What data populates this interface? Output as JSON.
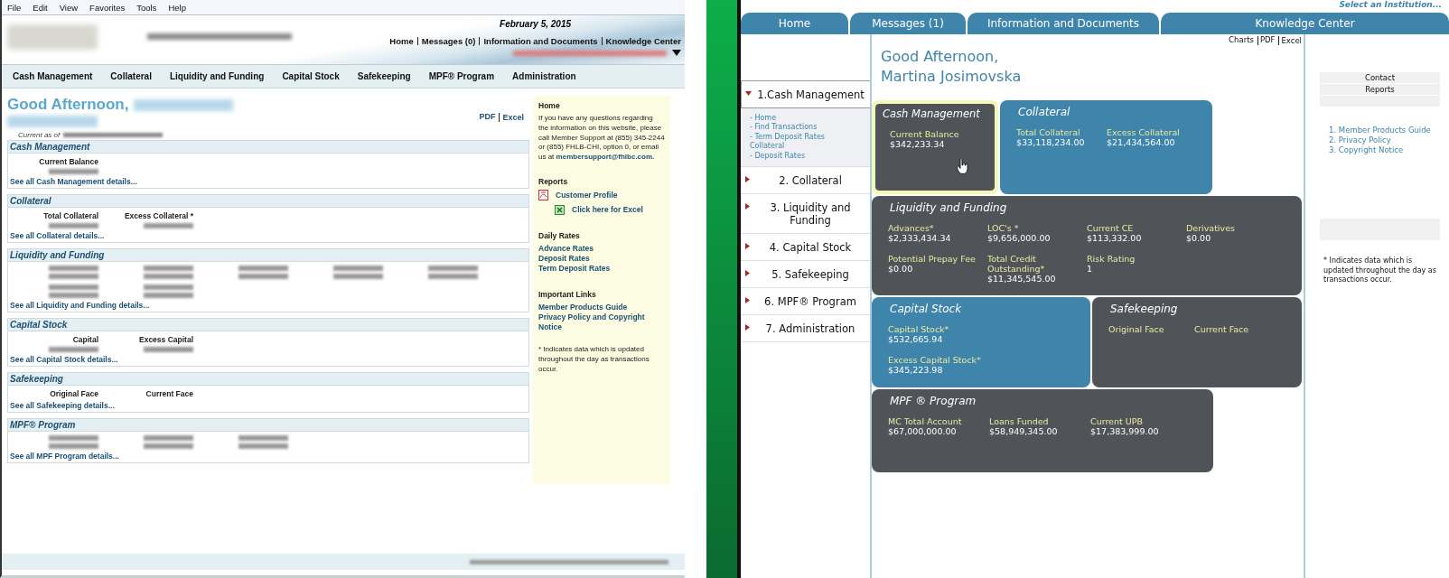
{
  "left_screen": {
    "menu_bar": [
      "File",
      "Edit",
      "View",
      "Favorites",
      "Tools",
      "Help"
    ],
    "date": "February 5, 2015",
    "top_links": [
      "Home",
      "Messages (0)",
      "Information and Documents",
      "Knowledge Center"
    ],
    "nav": [
      "Cash Management",
      "Collateral",
      "Liquidity and Funding",
      "Capital Stock",
      "Safekeeping",
      "MPF® Program",
      "Administration"
    ],
    "greeting": "Good Afternoon,",
    "current_as_of": "Current as of",
    "export_links": [
      "PDF",
      "Excel"
    ],
    "sections": [
      {
        "title": "Cash Management",
        "fields": [
          {
            "label": "Current Balance",
            "kind": "blurred_value"
          }
        ],
        "link": "See all Cash Management details..."
      },
      {
        "title": "Collateral",
        "fields": [
          {
            "label": "Total Collateral",
            "kind": "blurred_value"
          },
          {
            "label": "Excess Collateral *",
            "kind": "blurred_value"
          }
        ],
        "link": "See all Collateral details..."
      },
      {
        "title": "Liquidity and Funding",
        "fields": [
          {
            "kind": "blurred_value"
          },
          {
            "kind": "blurred_value"
          },
          {
            "kind": "blurred_value"
          },
          {
            "kind": "blurred_value"
          },
          {
            "kind": "blurred_value"
          },
          {
            "kind": "blurred_value"
          },
          {
            "kind": "blurred_value"
          }
        ],
        "link": "See all Liquidity and Funding details..."
      },
      {
        "title": "Capital Stock",
        "fields": [
          {
            "label": "Capital",
            "kind": "blurred_value"
          },
          {
            "label": "Excess Capital",
            "kind": "blurred_value"
          }
        ],
        "link": "See all Capital Stock details..."
      },
      {
        "title": "Safekeeping",
        "fields": [
          {
            "label": "Original Face",
            "kind": "label_only"
          },
          {
            "label": "Current Face",
            "kind": "label_only"
          }
        ],
        "link": "See all Safekeeping details..."
      },
      {
        "title": "MPF® Program",
        "fields": [
          {
            "kind": "blurred_value"
          },
          {
            "kind": "blurred_value"
          },
          {
            "kind": "blurred_value"
          }
        ],
        "link": "See all MPF Program details..."
      }
    ],
    "sidebar": {
      "home_title": "Home",
      "help_text": "If you have any questions regarding the information on this website, please call Member Support at (855) 345-2244 or (855) FHLB-CHI, option 0, or email us at",
      "email": "membersupport@fhlbc.com.",
      "reports_title": "Reports",
      "reports": [
        {
          "kind": "pdf",
          "label": "Customer Profile"
        },
        {
          "kind": "excel",
          "label": "Click here for Excel"
        }
      ],
      "rates_title": "Daily Rates",
      "rates": [
        "Advance Rates",
        "Deposit Rates",
        "Term Deposit Rates"
      ],
      "links_title": "Important Links",
      "links": [
        "Member Products Guide",
        "Privacy Policy and Copyright Notice"
      ],
      "footnote": "* Indicates data which is updated throughout the day as transactions occur."
    }
  },
  "right_screen": {
    "institution_link": "Select an Institution...",
    "tabs": [
      "Home",
      "Messages (1)",
      "Information and Documents",
      "Knowledge Center"
    ],
    "export_links": [
      "Charts",
      "PDF",
      "Excel"
    ],
    "greeting": [
      "Good Afternoon,",
      "Martina Josimovska"
    ],
    "nav": [
      {
        "label": "1.Cash Management",
        "expanded": true,
        "children": [
          "- Home",
          "- Find Transactions",
          "- Term Deposit Rates Collateral",
          "- Deposit Rates"
        ]
      },
      {
        "label": "2. Collateral",
        "expanded": false
      },
      {
        "label": "3. Liquidity and Funding",
        "expanded": false
      },
      {
        "label": "4. Capital Stock",
        "expanded": false
      },
      {
        "label": "5. Safekeeping",
        "expanded": false
      },
      {
        "label": "6. MPF® Program",
        "expanded": false
      },
      {
        "label": "7. Administration",
        "expanded": false
      }
    ],
    "cards": [
      {
        "title": "Cash Management",
        "color": "#505459",
        "highlighted": true,
        "fields": [
          {
            "label": "Current Balance",
            "value": "$342,233.34"
          }
        ]
      },
      {
        "title": "Collateral",
        "color": "#3f84aa",
        "highlighted": false,
        "fields": [
          {
            "label": "Total Collateral",
            "value": "$33,118,234.00"
          },
          {
            "label": "Excess Collateral",
            "value": "$21,434,564.00"
          }
        ]
      },
      {
        "title": "Liquidity and Funding",
        "color": "#505459",
        "highlighted": false,
        "fields": [
          {
            "label": "Advances*",
            "value": "$2,333,434.34"
          },
          {
            "label": "LOC's *",
            "value": "$9,656,000.00"
          },
          {
            "label": "Current CE",
            "value": "$113,332.00"
          },
          {
            "label": "Derivatives",
            "value": "$0.00"
          },
          {
            "label": "Potential Prepay Fee",
            "value": "$0.00"
          },
          {
            "label": "Total Credit Outstanding*",
            "value": "$11,345,545.00"
          },
          {
            "label": "Risk Rating",
            "value": "1"
          }
        ]
      },
      {
        "title": "Capital Stock",
        "color": "#3f84aa",
        "highlighted": false,
        "fields": [
          {
            "label": "Capital Stock*",
            "value": "$532,665.94"
          },
          {
            "label": "Excess Capital Stock*",
            "value": "$345,223.98"
          }
        ]
      },
      {
        "title": "Safekeeping",
        "color": "#505459",
        "highlighted": false,
        "fields": [
          {
            "label": "Original Face"
          },
          {
            "label": "Current Face"
          }
        ]
      },
      {
        "title": "MPF ® Program",
        "color": "#505459",
        "highlighted": false,
        "fields": [
          {
            "label": "MC Total Account",
            "value": "$67,000,000.00"
          },
          {
            "label": "Loans Funded",
            "value": "$58,949,345.00"
          },
          {
            "label": "Current UPB",
            "value": "$17,383,999.00"
          }
        ]
      }
    ],
    "sidebar": {
      "rows": [
        "Contact",
        "Reports"
      ],
      "links": [
        "1. Member Products Guide",
        "2. Privacy Policy",
        "3. Copyright Notice"
      ],
      "footnote": "* Indicates data which is updated throughout the day as transactions occur."
    }
  }
}
